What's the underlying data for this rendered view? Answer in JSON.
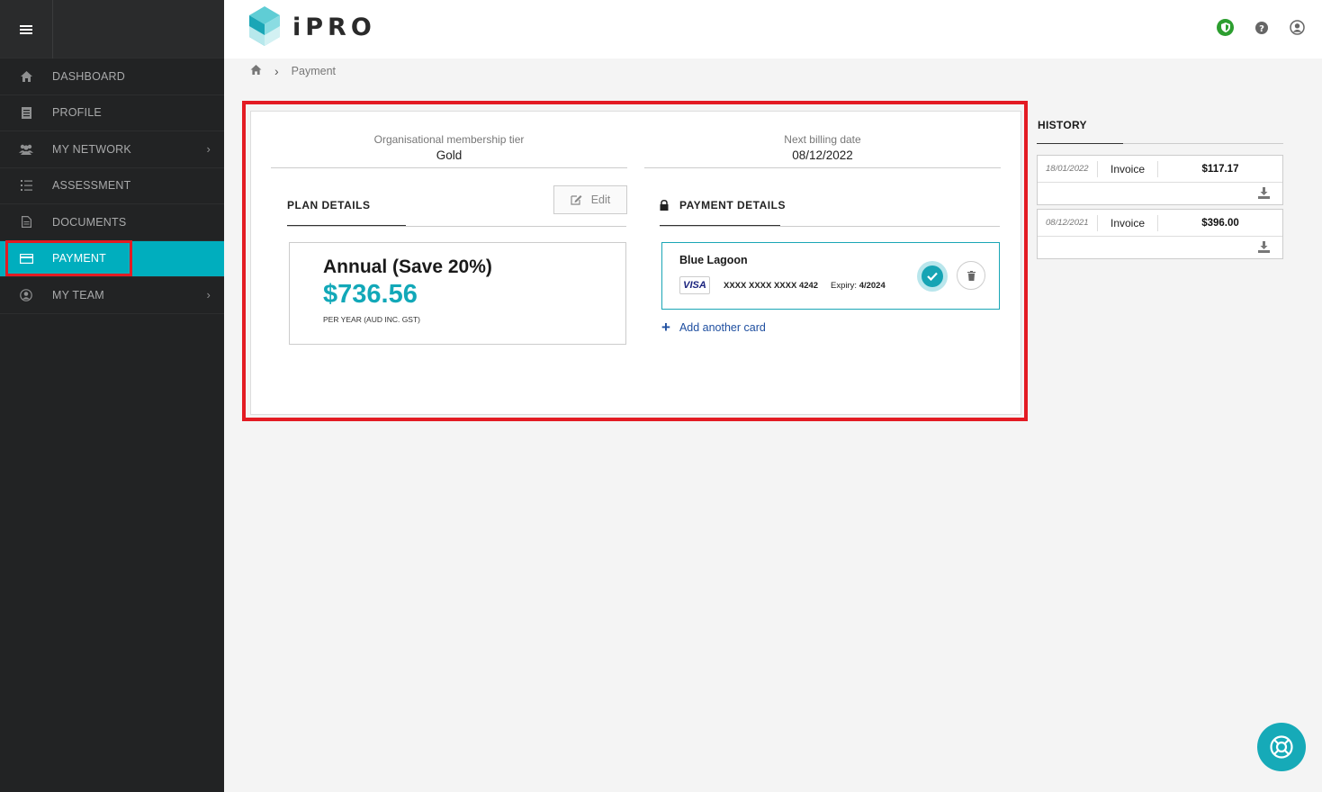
{
  "app": {
    "logo_text": "iPRO"
  },
  "sidebar": {
    "items": [
      {
        "label": "DASHBOARD",
        "icon": "home-icon"
      },
      {
        "label": "PROFILE",
        "icon": "document-icon"
      },
      {
        "label": "MY NETWORK",
        "icon": "users-icon",
        "has_children": true
      },
      {
        "label": "ASSESSMENT",
        "icon": "list-icon"
      },
      {
        "label": "DOCUMENTS",
        "icon": "file-icon"
      },
      {
        "label": "PAYMENT",
        "icon": "credit-card-icon",
        "active": true
      },
      {
        "label": "MY TEAM",
        "icon": "user-circle-icon",
        "has_children": true
      }
    ]
  },
  "breadcrumb": {
    "separator": "›",
    "current": "Payment"
  },
  "summary": {
    "tier_label": "Organisational membership tier",
    "tier_value": "Gold",
    "billing_label": "Next billing date",
    "billing_value": "08/12/2022"
  },
  "plan": {
    "section_title": "PLAN DETAILS",
    "edit_label": "Edit",
    "name": "Annual (Save 20%)",
    "price": "$736.56",
    "period": "PER YEAR (AUD INC. GST)"
  },
  "payment": {
    "section_title": "PAYMENT DETAILS",
    "card_name": "Blue Lagoon",
    "card_brand": "VISA",
    "card_number": "XXXX XXXX XXXX 4242",
    "expiry_label": "Expiry:",
    "expiry_value": "4/2024",
    "add_card_label": "Add another card"
  },
  "history": {
    "title": "HISTORY",
    "items": [
      {
        "date": "18/01/2022",
        "label": "Invoice",
        "amount": "$117.17"
      },
      {
        "date": "08/12/2021",
        "label": "Invoice",
        "amount": "$396.00"
      }
    ]
  },
  "colors": {
    "accent": "#00aebe",
    "highlight": "#e31b23",
    "sidebar_bg": "#222324",
    "link": "#1f4fa0"
  }
}
